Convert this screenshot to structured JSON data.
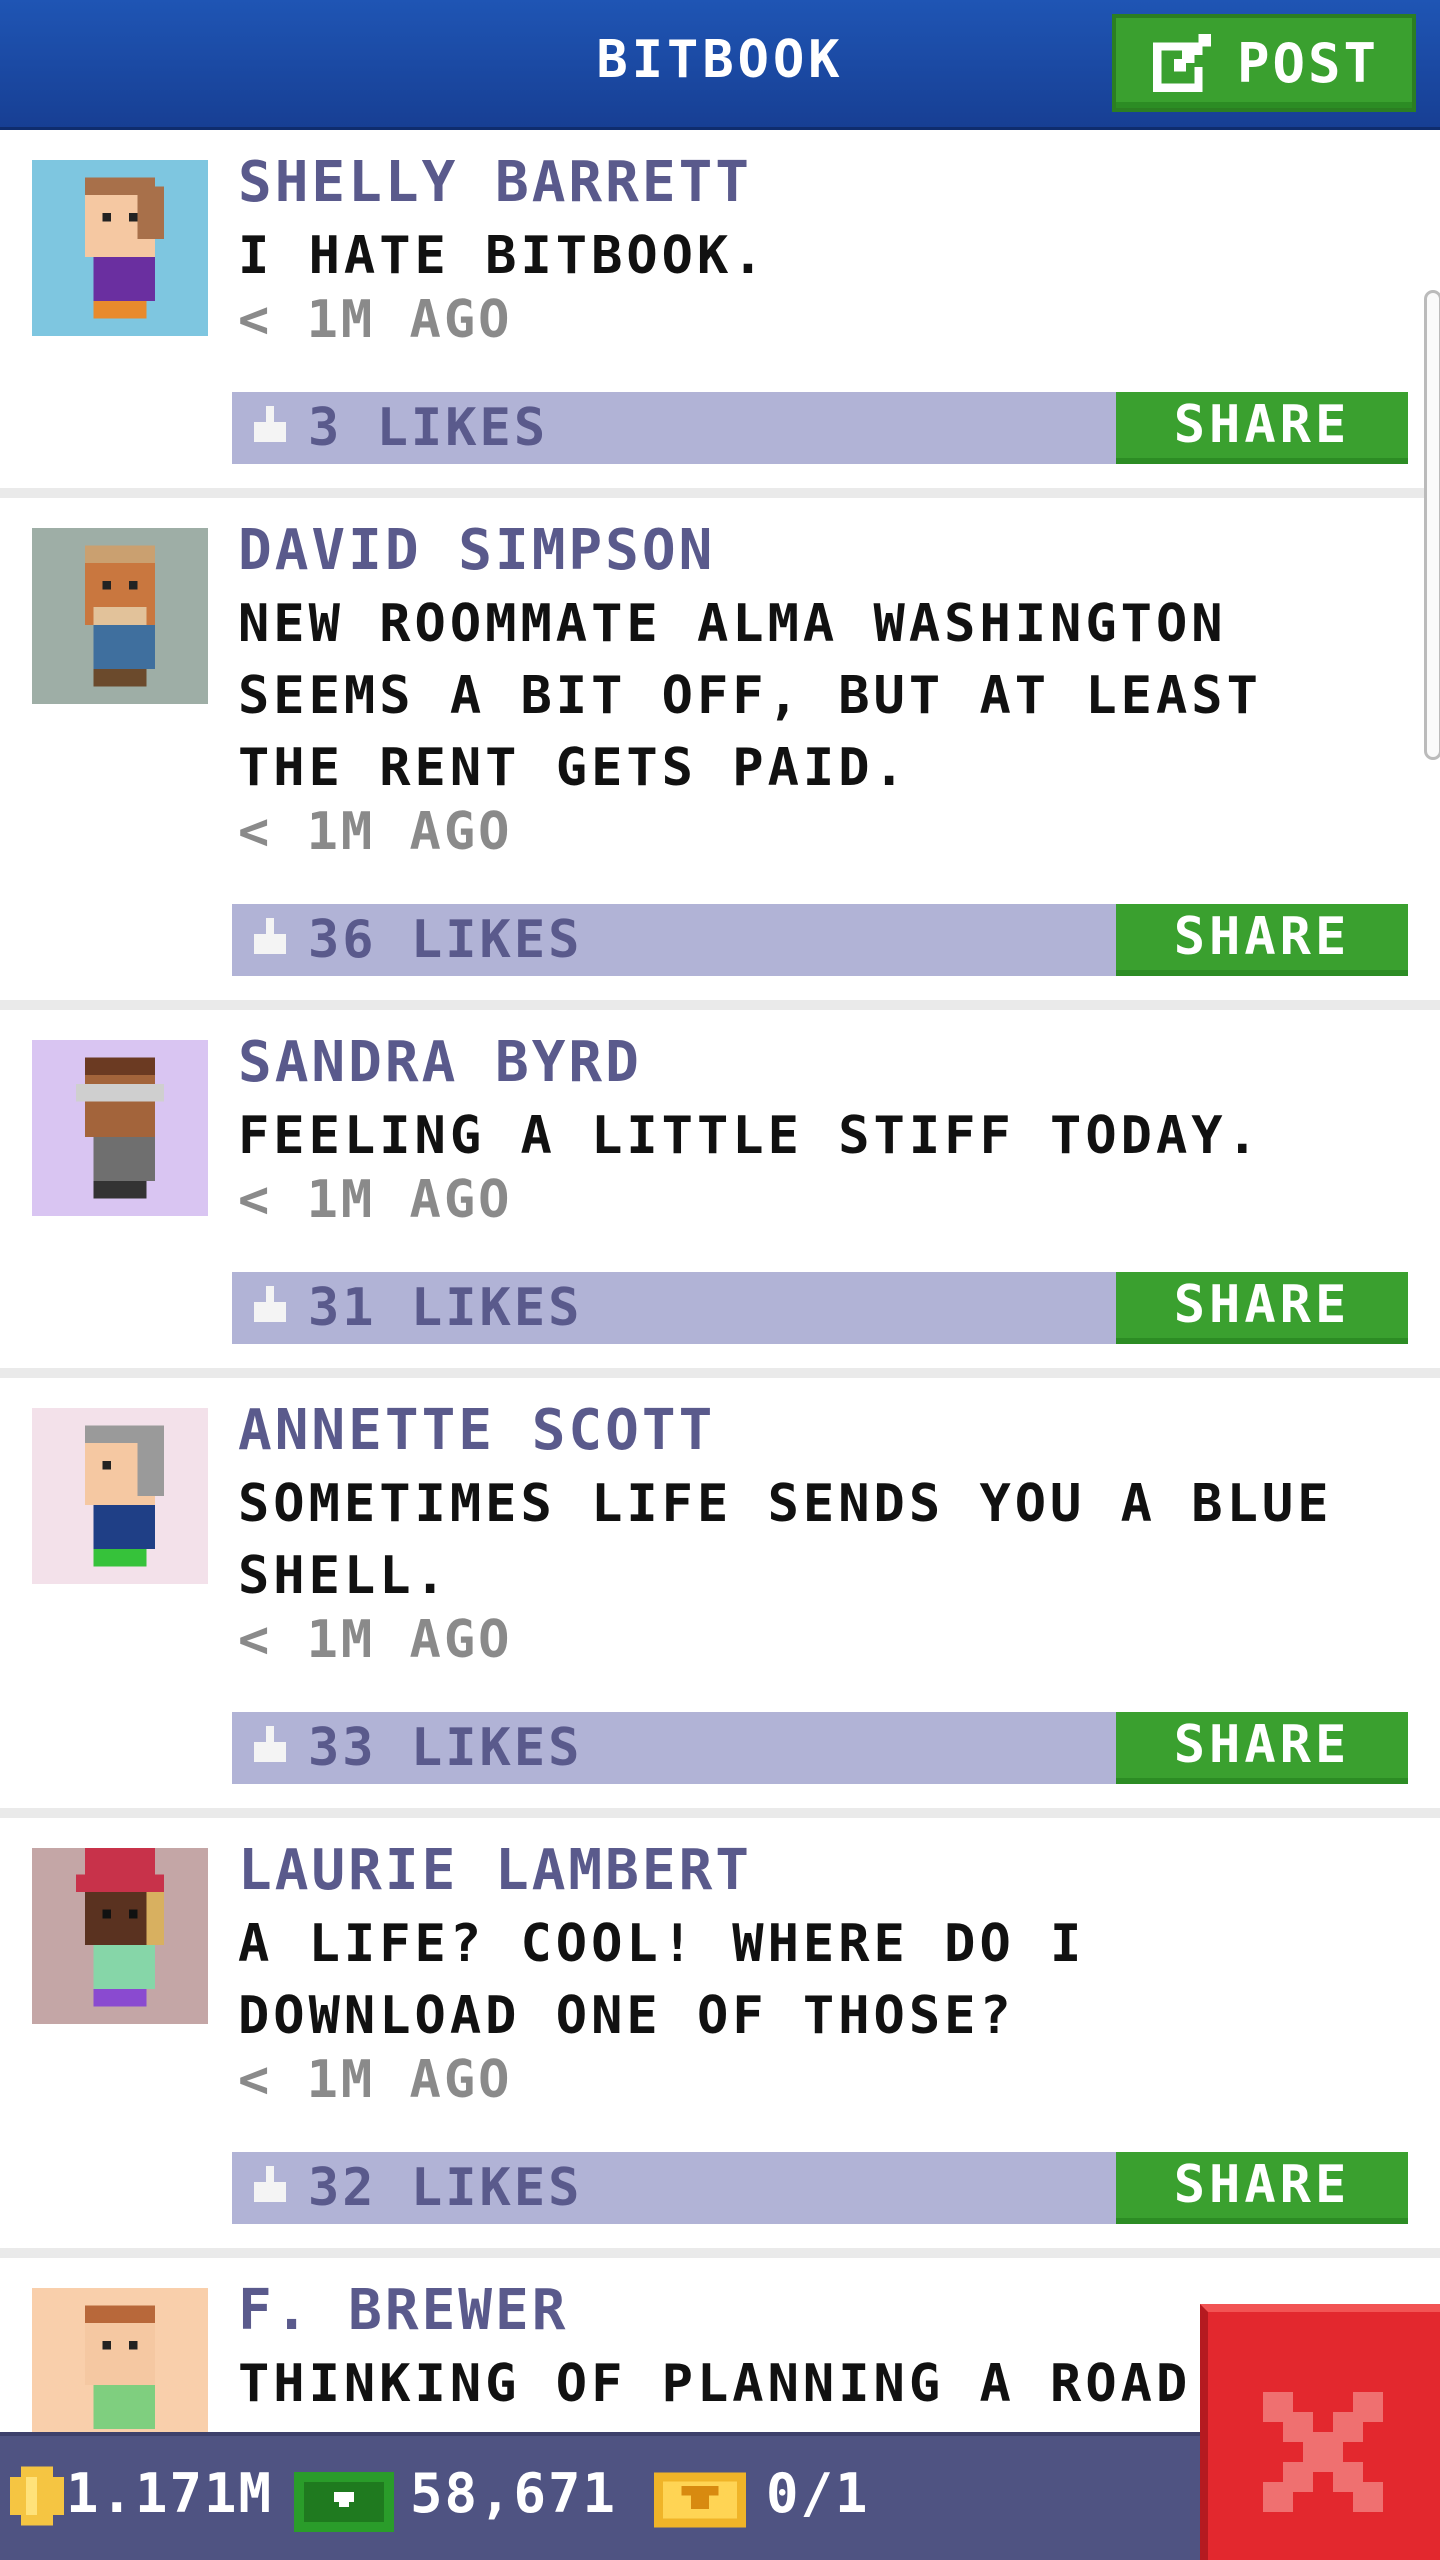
{
  "header": {
    "title": "BITBOOK",
    "post_label": "POST"
  },
  "posts": [
    {
      "name": "SHELLY BARRETT",
      "message": "I HATE BITBOOK.",
      "time": "< 1M AGO",
      "likes": "3 LIKES",
      "share_label": "SHARE",
      "avatar_bg": "#7ec6e0"
    },
    {
      "name": "DAVID SIMPSON",
      "message": "NEW ROOMMATE ALMA WASHINGTON SEEMS A BIT OFF, BUT AT LEAST THE RENT GETS PAID.",
      "time": "< 1M AGO",
      "likes": "36 LIKES",
      "share_label": "SHARE",
      "avatar_bg": "#9eaea6"
    },
    {
      "name": "SANDRA BYRD",
      "message": "FEELING A LITTLE STIFF TODAY.",
      "time": "< 1M AGO",
      "likes": "31 LIKES",
      "share_label": "SHARE",
      "avatar_bg": "#d9c5f2"
    },
    {
      "name": "ANNETTE SCOTT",
      "message": "SOMETIMES LIFE SENDS YOU A BLUE SHELL.",
      "time": "< 1M AGO",
      "likes": "33 LIKES",
      "share_label": "SHARE",
      "avatar_bg": "#f3e1ea"
    },
    {
      "name": "LAURIE LAMBERT",
      "message": "A LIFE? COOL! WHERE DO I DOWNLOAD ONE OF THOSE?",
      "time": "< 1M AGO",
      "likes": "32 LIKES",
      "share_label": "SHARE",
      "avatar_bg": "#c4a6a6"
    },
    {
      "name": "F. BREWER",
      "message": "THINKING OF PLANNING A ROAD",
      "avatar_bg": "#f9cfab"
    }
  ],
  "status": {
    "coins": "1.171M",
    "bux": "58,671",
    "tickets": "0/1"
  },
  "colors": {
    "header": "#1f55b4",
    "accent_green": "#3aa02f",
    "likes_bar": "#b1b3d6",
    "close_red": "#e3282e",
    "status_bar": "#4f5382"
  }
}
